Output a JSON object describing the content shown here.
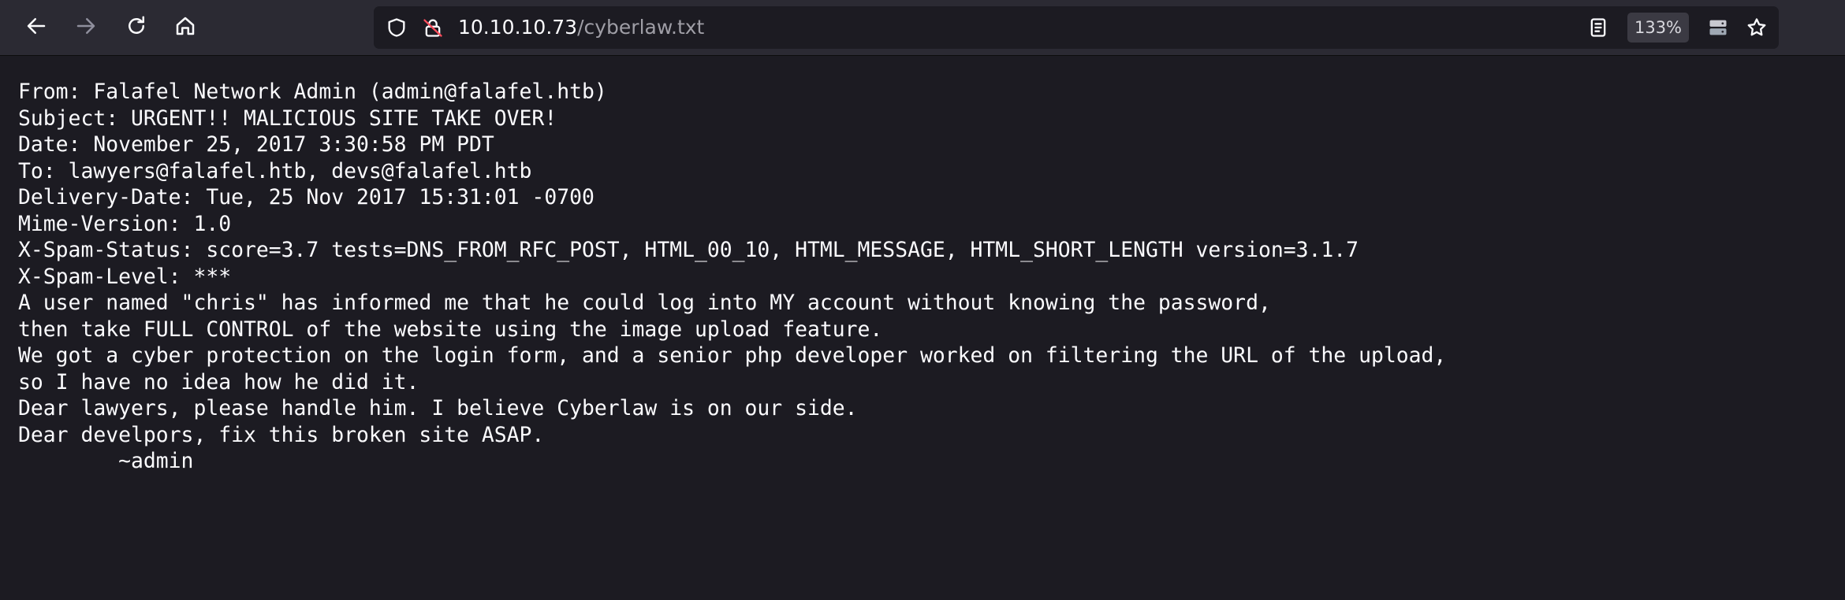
{
  "browser": {
    "url_host": "10.10.10.73",
    "url_path": "/cyberlaw.txt",
    "zoom_level": "133%",
    "icons": {
      "back": "back-arrow-icon",
      "forward": "forward-arrow-icon",
      "reload": "reload-icon",
      "home": "home-icon",
      "tracking": "shield-icon",
      "insecure": "insecure-lock-icon",
      "reader": "reader-view-icon",
      "server": "server-icon",
      "bookmark": "star-icon"
    }
  },
  "document": {
    "lines": [
      "From: Falafel Network Admin (admin@falafel.htb)",
      "Subject: URGENT!! MALICIOUS SITE TAKE OVER!",
      "Date: November 25, 2017 3:30:58 PM PDT",
      "To: lawyers@falafel.htb, devs@falafel.htb",
      "Delivery-Date: Tue, 25 Nov 2017 15:31:01 -0700",
      "Mime-Version: 1.0",
      "X-Spam-Status: score=3.7 tests=DNS_FROM_RFC_POST, HTML_00_10, HTML_MESSAGE, HTML_SHORT_LENGTH version=3.1.7",
      "X-Spam-Level: ***",
      "A user named \"chris\" has informed me that he could log into MY account without knowing the password,",
      "then take FULL CONTROL of the website using the image upload feature.",
      "We got a cyber protection on the login form, and a senior php developer worked on filtering the URL of the upload,",
      "so I have no idea how he did it.",
      "Dear lawyers, please handle him. I believe Cyberlaw is on our side.",
      "Dear develpors, fix this broken site ASAP.",
      "        ~admin"
    ]
  }
}
